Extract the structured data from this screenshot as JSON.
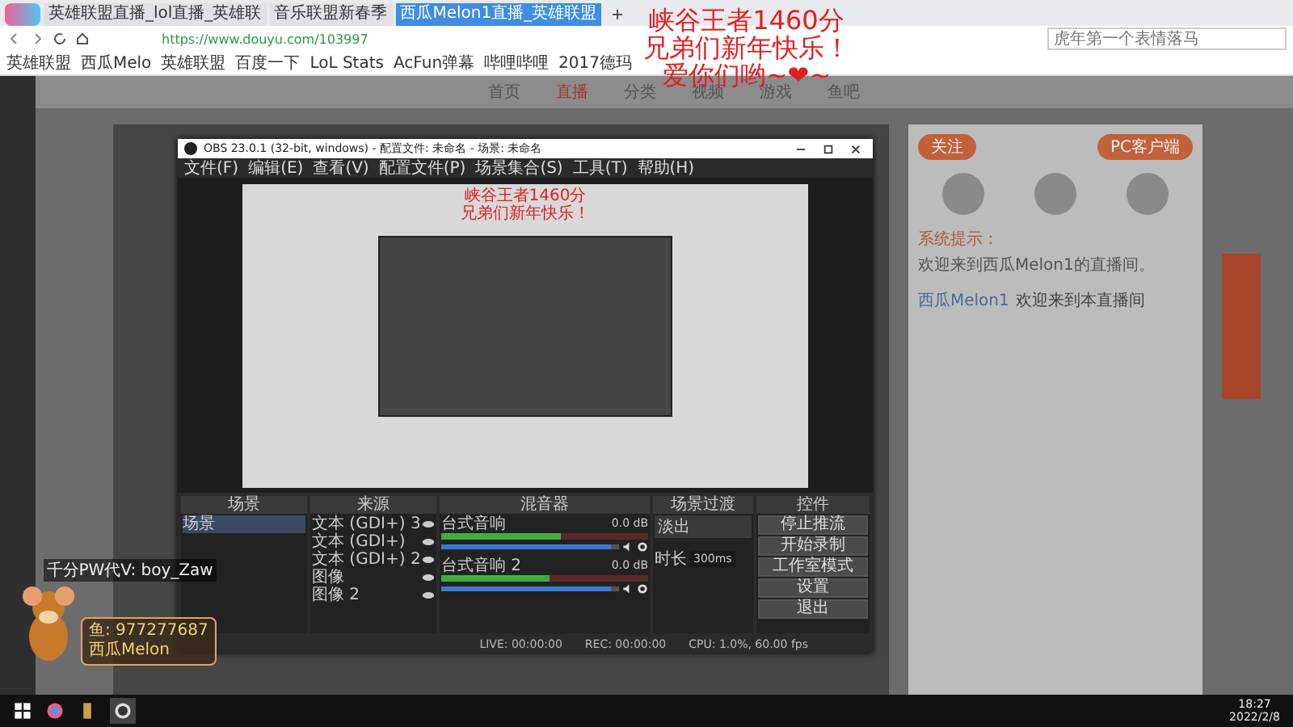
{
  "browser": {
    "tabs": [
      {
        "label": "英雄联盟直播_lol直播_英雄联",
        "selected": false
      },
      {
        "label": "音乐联盟新春季",
        "selected": false
      },
      {
        "label": "西瓜Melon1直播_英雄联盟",
        "selected": true
      }
    ],
    "url": "https://www.douyu.com/103997",
    "search_placeholder": "虎年第一个表情落马",
    "bookmarks": [
      "英雄联盟",
      "西瓜Melo",
      "英雄联盟",
      "百度一下",
      "LoL Stats",
      "AcFun弹幕",
      "哔哩哔哩",
      "2017德玛"
    ]
  },
  "site": {
    "nav": [
      {
        "label": "首页",
        "selected": false
      },
      {
        "label": "直播",
        "selected": true
      },
      {
        "label": "分类",
        "selected": false
      },
      {
        "label": "视频",
        "selected": false
      },
      {
        "label": "游戏",
        "selected": false
      },
      {
        "label": "鱼吧",
        "selected": false
      }
    ],
    "client_button": "PC客户端",
    "follow_button": "关注",
    "notice_label": "系统提示：",
    "notice_text": "欢迎来到西瓜Melon1的直播间。",
    "chat": [
      {
        "user": "西瓜Melon1",
        "text": "欢迎来到本直播间"
      }
    ]
  },
  "overlay_text": [
    "峡谷王者1460分",
    "兄弟们新年快乐！",
    "爱你们哟~❤~"
  ],
  "obs": {
    "title": "OBS 23.0.1 (32-bit, windows) - 配置文件: 未命名 - 场景: 未命名",
    "menu": [
      "文件(F)",
      "编辑(E)",
      "查看(V)",
      "配置文件(P)",
      "场景集合(S)",
      "工具(T)",
      "帮助(H)"
    ],
    "preview_text": [
      "峡谷王者1460分",
      "兄弟们新年快乐！"
    ],
    "scenes": {
      "title": "场景",
      "items": [
        {
          "label": "场景",
          "selected": true
        }
      ]
    },
    "sources": {
      "title": "来源",
      "items": [
        "文本 (GDI+) 3",
        "文本 (GDI+)",
        "文本 (GDI+) 2",
        "图像",
        "图像 2"
      ]
    },
    "mixer": {
      "title": "混音器",
      "channels": [
        {
          "name": "台式音响",
          "reading": "0.0 dB",
          "meter": {
            "level": 0.58
          },
          "volume": {
            "level": 0.95
          }
        },
        {
          "name": "台式音响 2",
          "reading": "0.0 dB",
          "meter": {
            "level": 0.52
          },
          "volume": {
            "level": 0.95
          }
        }
      ]
    },
    "transitions": {
      "title": "场景过渡",
      "type": "淡出",
      "duration_label": "时长",
      "duration": "300ms"
    },
    "controls": {
      "title": "控件",
      "buttons": [
        "停止推流",
        "开始录制",
        "工作室模式",
        "设置",
        "退出"
      ]
    },
    "status": [
      "LIVE: 00:00:00",
      "REC: 00:00:00",
      "CPU: 1.0%, 60.00 fps"
    ]
  },
  "stream_overlay": {
    "caption": "千分PW代V: boy_Zaw",
    "card_lines": [
      "鱼: 977277687",
      "西瓜Melon"
    ]
  },
  "taskbar": {
    "time": "18:27",
    "date": "2022/2/8"
  }
}
